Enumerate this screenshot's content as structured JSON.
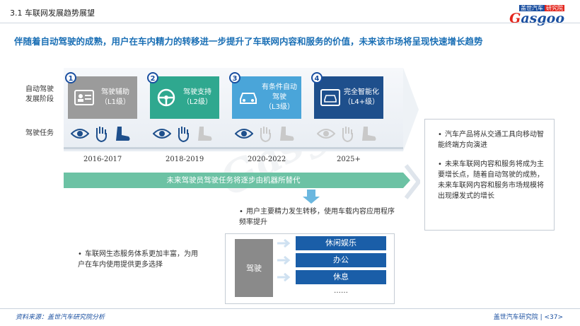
{
  "header": {
    "title": "3.1 车联网发展趋势展望"
  },
  "logo": {
    "top_a": "盖世汽车",
    "top_b": "研究院",
    "main_g": "G",
    "main_rest": "asgoo"
  },
  "headline": "伴随着自动驾驶的成熟，用户在车内精力的转移进一步提升了车联网内容和服务的价值，未来该市场将呈现快速增长趋势",
  "row_labels": {
    "stage": "自动驾驶\n发展阶段",
    "task": "驾驶任务"
  },
  "stages": [
    {
      "num": "1",
      "line1": "驾驶辅助",
      "line2": "（L1级）",
      "color": "#9b9b9b",
      "icon": "driver-license-icon"
    },
    {
      "num": "2",
      "line1": "驾驶支持",
      "line2": "（L2级）",
      "color": "#2fa88f",
      "icon": "steering-wheel-icon"
    },
    {
      "num": "3",
      "line1": "有条件自动驾驶",
      "line2": "（L3级）",
      "color": "#4aa5d9",
      "icon": "car-icon"
    },
    {
      "num": "4",
      "line1": "完全智能化",
      "line2": "（L4+级）",
      "color": "#1e4f8c",
      "icon": "smart-car-icon"
    }
  ],
  "years": [
    "2016-2017",
    "2018-2019",
    "2020-2022",
    "2025+"
  ],
  "green_bar": "未来驾驶员驾驶任务将逐步由机器所替代",
  "center_bullet": "用户主要精力发生转移，使用车载内容应用程序频率提升",
  "left_bullet": "车联网生态服务体系更加丰富，为用户在车内使用提供更多选择",
  "drive_label": "驾驶",
  "services": [
    "休闲娱乐",
    "办公",
    "休息"
  ],
  "services_more": "……",
  "right_bullets": [
    "汽车产品将从交通工具向移动智能终端方向演进",
    "未来车联网内容和服务将成为主要增长点，随着自动驾驶的成熟，未来车联网内容和服务市场规模将出现爆发式的增长"
  ],
  "footer": {
    "source": "资料来源：盖世汽车研究院分析",
    "right": "盖世汽车研究院 | <37>"
  },
  "colors": {
    "accent": "#1a6fb5",
    "green": "#6cc2a4",
    "navy": "#1a5ea8"
  }
}
